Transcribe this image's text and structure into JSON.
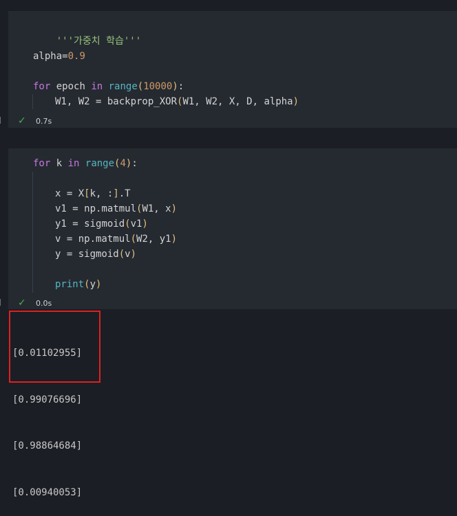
{
  "cell1": {
    "comment": "'''가중치 학습'''",
    "alpha_var": "alpha",
    "alpha_eq": "=",
    "alpha_val": "0.9",
    "for_kw": "for",
    "loop_var": " epoch ",
    "in_kw": "in",
    "range_fn": "range",
    "range_open": "(",
    "range_val": "10000",
    "range_close": ")",
    "colon": ":",
    "body_lhs": "W1, W2 = backprop_XOR",
    "body_open": "(",
    "body_args": "W1, W2, X, D, alpha",
    "body_close": ")",
    "status_time": "0.7s",
    "status_check": "✓"
  },
  "cell2": {
    "l1_for": "for",
    "l1_var": " k ",
    "l1_in": "in",
    "l1_range": "range",
    "l1_open": "(",
    "l1_num": "4",
    "l1_close": ")",
    "l1_colon": ":",
    "l2_a": "x = X",
    "l2_open": "[",
    "l2_b": "k, :",
    "l2_close": "]",
    "l2_c": ".T",
    "l3_a": "v1 = np.matmul",
    "l3_open": "(",
    "l3_b": "W1, x",
    "l3_close": ")",
    "l4_a": "y1 = ",
    "l4_fn": "sigmoid",
    "l4_open": "(",
    "l4_b": "v1",
    "l4_close": ")",
    "l5_a": "v = np.matmul",
    "l5_open": "(",
    "l5_b": "W2, y1",
    "l5_close": ")",
    "l6_a": "y = ",
    "l6_fn": "sigmoid",
    "l6_open": "(",
    "l6_b": "v",
    "l6_close": ")",
    "l7_fn": "print",
    "l7_open": "(",
    "l7_b": "y",
    "l7_close": ")",
    "status_time": "0.0s",
    "status_check": "✓"
  },
  "output": {
    "lines": [
      "[0.01102955]",
      "[0.99076696]",
      "[0.98864684]",
      "[0.00940053]"
    ]
  },
  "colors": {
    "highlight_border": "#e02020",
    "success_check": "#4caf50"
  }
}
